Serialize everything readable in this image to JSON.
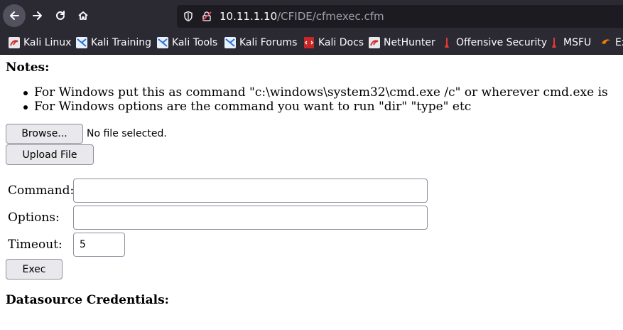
{
  "browser": {
    "url": {
      "host": "10.11.1.10",
      "path": "/CFIDE/cfmexec.cfm"
    },
    "bookmarks": [
      {
        "label": "Kali Linux",
        "icon": "kali-dragon-icon"
      },
      {
        "label": "Kali Training",
        "icon": "kali-training-icon"
      },
      {
        "label": "Kali Tools",
        "icon": "kali-tools-icon"
      },
      {
        "label": "Kali Forums",
        "icon": "kali-forums-icon"
      },
      {
        "label": "Kali Docs",
        "icon": "kali-docs-icon"
      },
      {
        "label": "NetHunter",
        "icon": "nethunter-icon"
      },
      {
        "label": "Offensive Security",
        "icon": "offsec-icon"
      },
      {
        "label": "MSFU",
        "icon": "msfu-icon"
      },
      {
        "label": "Ex",
        "icon": "exploit-db-icon"
      }
    ]
  },
  "page": {
    "notes_heading": "Notes:",
    "notes": [
      "For Windows put this as command \"c:\\windows\\system32\\cmd.exe /c\" or wherever cmd.exe is",
      "For Windows options are the command you want to run \"dir\" \"type\" etc"
    ],
    "upload": {
      "browse_label": "Browse...",
      "file_status": "No file selected.",
      "upload_label": "Upload File"
    },
    "exec_form": {
      "command_label": "Command:",
      "command_value": "",
      "options_label": "Options:",
      "options_value": "",
      "timeout_label": "Timeout:",
      "timeout_value": "5",
      "exec_label": "Exec"
    },
    "datasource_heading": "Datasource Credentials:"
  },
  "colors": {
    "toolbar_bg": "#2b2a33",
    "urlbar_bg": "#1c1b22",
    "button_bg": "#e9e9ed",
    "button_border": "#8f8f9d"
  }
}
